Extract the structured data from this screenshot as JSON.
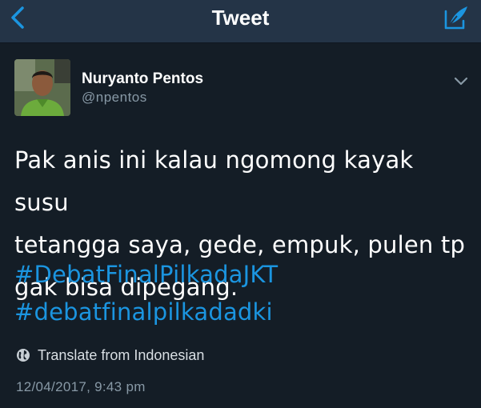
{
  "header": {
    "title": "Tweet",
    "back_icon": "chevron-left-icon",
    "compose_icon": "compose-tweet-icon",
    "accent_color": "#1b95e0"
  },
  "tweet": {
    "author": {
      "display_name": "Nuryanto Pentos",
      "handle": "@npentos",
      "avatar_icon": "avatar"
    },
    "text_lines": [
      "Pak anis ini kalau ngomong kayak susu",
      "tetangga saya, gede, empuk, pulen tp",
      "gak bisa dipegang."
    ],
    "hashtags": [
      "#DebatFinalPilkadaJKT",
      "#debatfinalpilkadadki"
    ],
    "translate_label": "Translate from Indonesian",
    "timestamp": "12/04/2017, 9:43 pm"
  },
  "colors": {
    "background": "#141d26",
    "navbar": "#243447",
    "secondary_text": "#8899a6",
    "link": "#1b95e0"
  }
}
